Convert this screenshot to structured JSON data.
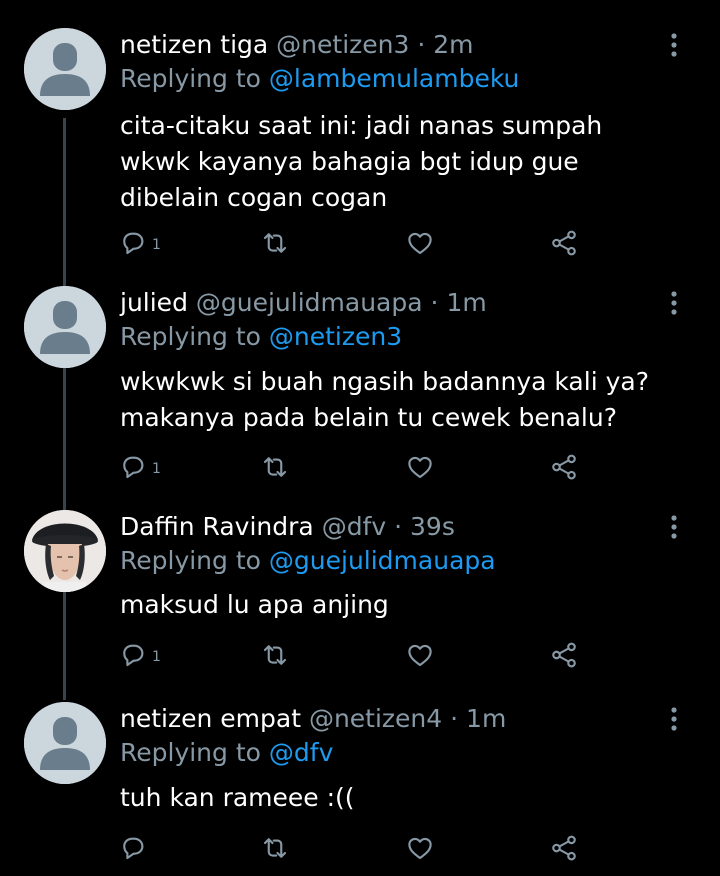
{
  "tweets": [
    {
      "name": "netizen tiga",
      "handle": "@netizen3",
      "dot": "·",
      "time": "2m",
      "replying_prefix": "Replying to",
      "replying_to": "@lambemulambeku",
      "text": "cita-citaku saat ini: jadi nanas sumpah\nwkwk kayanya bahagia bgt idup gue\ndibelain cogan cogan",
      "reply_count": "1",
      "avatar": "default-avatar"
    },
    {
      "name": "julied",
      "handle": "@guejulidmauapa",
      "dot": "·",
      "time": "1m",
      "replying_prefix": "Replying to",
      "replying_to": "@netizen3",
      "text": "wkwkwk si buah ngasih badannya kali ya?\nmakanya pada belain tu cewek benalu?",
      "reply_count": "1",
      "avatar": "default-avatar"
    },
    {
      "name": "Daffin Ravindra",
      "handle": "@dfv",
      "dot": "·",
      "time": "39s",
      "replying_prefix": "Replying to",
      "replying_to": "@guejulidmauapa",
      "text": "maksud lu apa anjing",
      "reply_count": "1",
      "avatar": "photo-avatar"
    },
    {
      "name": "netizen empat",
      "handle": "@netizen4",
      "dot": "·",
      "time": "1m",
      "replying_prefix": "Replying to",
      "replying_to": "@dfv",
      "text": "tuh kan rameee :((",
      "reply_count": "",
      "avatar": "default-avatar"
    }
  ],
  "icons": {
    "reply": "reply-icon",
    "retweet": "retweet-icon",
    "like": "heart-icon",
    "share": "share-icon",
    "more": "more-options-icon"
  },
  "colors": {
    "background": "#000000",
    "text": "#ffffff",
    "secondary": "#8899a6",
    "link": "#1d9bf0",
    "thread_line": "#38444d",
    "avatar_bg": "#ccd6dd",
    "avatar_fg": "#6a7d8c"
  }
}
